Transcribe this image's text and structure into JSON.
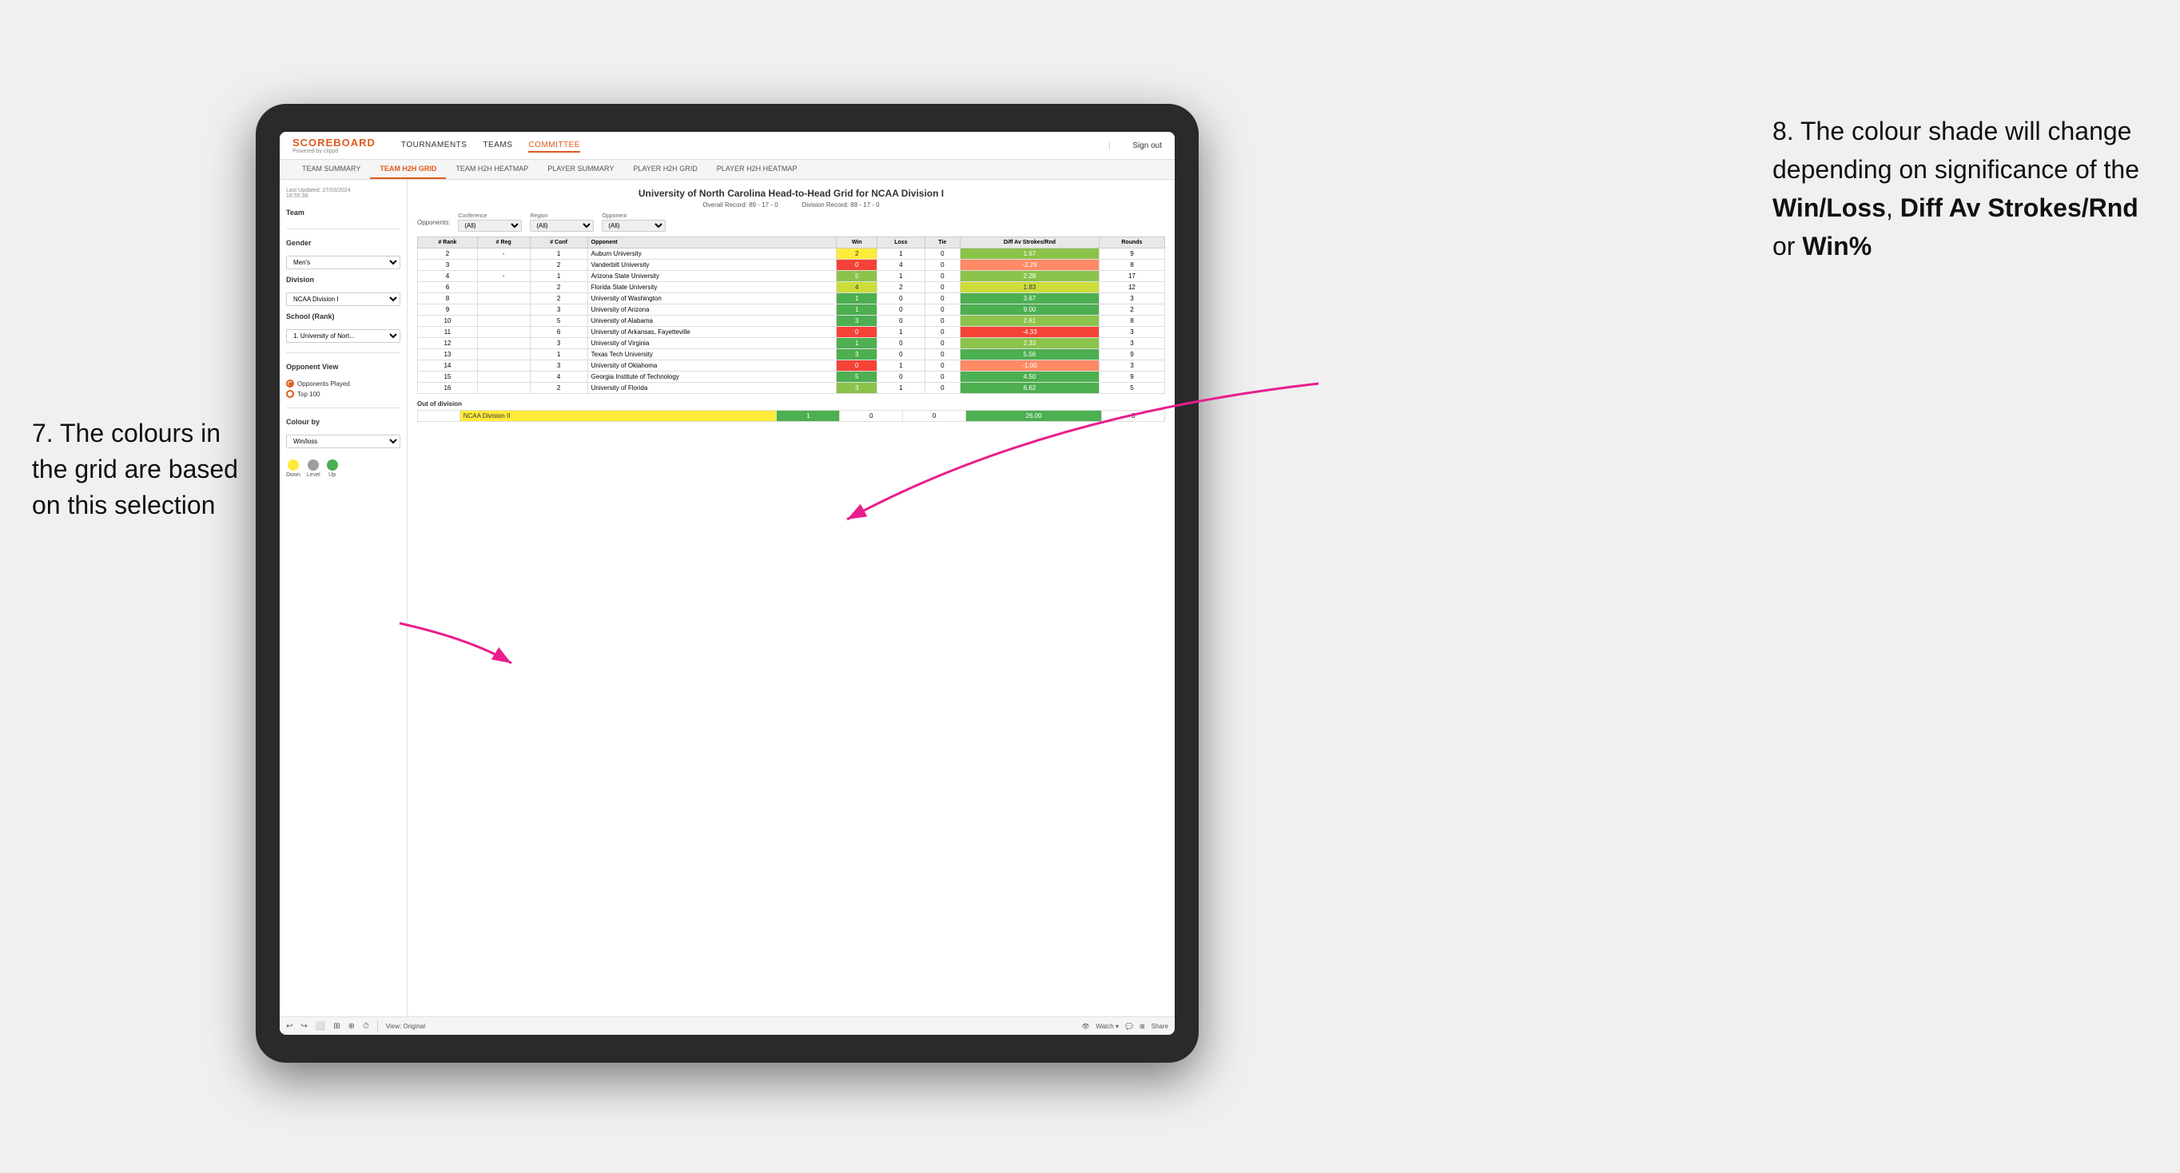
{
  "annotations": {
    "left_text": "7. The colours in the grid are based on this selection",
    "right_title": "8. The colour shade will change depending on significance of the",
    "right_bold1": "Win/Loss",
    "right_comma": ", ",
    "right_bold2": "Diff Av Strokes/Rnd",
    "right_or": " or ",
    "right_bold3": "Win%"
  },
  "nav": {
    "logo": "SCOREBOARD",
    "logo_sub": "Powered by clippd",
    "links": [
      "TOURNAMENTS",
      "TEAMS",
      "COMMITTEE"
    ],
    "sign_out": "Sign out"
  },
  "sub_tabs": [
    "TEAM SUMMARY",
    "TEAM H2H GRID",
    "TEAM H2H HEATMAP",
    "PLAYER SUMMARY",
    "PLAYER H2H GRID",
    "PLAYER H2H HEATMAP"
  ],
  "active_sub_tab": "TEAM H2H GRID",
  "left_panel": {
    "last_updated_label": "Last Updated: 27/03/2024",
    "last_updated_time": "16:55:38",
    "team_label": "Team",
    "gender_label": "Gender",
    "gender_value": "Men's",
    "division_label": "Division",
    "division_value": "NCAA Division I",
    "school_rank_label": "School (Rank)",
    "school_value": "1. University of Nort...",
    "opponent_view_label": "Opponent View",
    "opponents_played": "Opponents Played",
    "top100": "Top 100",
    "colour_by_label": "Colour by",
    "colour_by_value": "Win/loss",
    "legend": {
      "down_label": "Down",
      "level_label": "Level",
      "up_label": "Up",
      "down_color": "#ffeb3b",
      "level_color": "#9e9e9e",
      "up_color": "#4caf50"
    }
  },
  "grid": {
    "title": "University of North Carolina Head-to-Head Grid for NCAA Division I",
    "overall_record": "Overall Record: 89 - 17 - 0",
    "division_record": "Division Record: 88 - 17 - 0",
    "filter_conference_label": "Conference",
    "filter_conference_value": "(All)",
    "filter_region_label": "Region",
    "filter_region_value": "(All)",
    "filter_opponent_label": "Opponent",
    "filter_opponent_value": "(All)",
    "opponents_label": "Opponents:",
    "columns": [
      "#\nRank",
      "#\nReg",
      "#\nConf",
      "Opponent",
      "Win",
      "Loss",
      "Tie",
      "Diff Av\nStrokes/Rnd",
      "Rounds"
    ],
    "rows": [
      {
        "rank": "2",
        "reg": "-",
        "conf": "1",
        "opponent": "Auburn University",
        "win": "2",
        "loss": "1",
        "tie": "0",
        "diff": "1.67",
        "rounds": "9",
        "win_color": "yellow",
        "diff_color": "green_mid"
      },
      {
        "rank": "3",
        "reg": "",
        "conf": "2",
        "opponent": "Vanderbilt University",
        "win": "0",
        "loss": "4",
        "tie": "0",
        "diff": "-2.29",
        "rounds": "8",
        "win_color": "red_mid",
        "diff_color": "red_light"
      },
      {
        "rank": "4",
        "reg": "-",
        "conf": "1",
        "opponent": "Arizona State University",
        "win": "5",
        "loss": "1",
        "tie": "0",
        "diff": "2.28",
        "rounds": "17",
        "win_color": "green_mid",
        "diff_color": "green_mid"
      },
      {
        "rank": "6",
        "reg": "",
        "conf": "2",
        "opponent": "Florida State University",
        "win": "4",
        "loss": "2",
        "tie": "0",
        "diff": "1.83",
        "rounds": "12",
        "win_color": "green_light",
        "diff_color": "green_light"
      },
      {
        "rank": "8",
        "reg": "",
        "conf": "2",
        "opponent": "University of Washington",
        "win": "1",
        "loss": "0",
        "tie": "0",
        "diff": "3.67",
        "rounds": "3",
        "win_color": "green_strong",
        "diff_color": "green_strong"
      },
      {
        "rank": "9",
        "reg": "",
        "conf": "3",
        "opponent": "University of Arizona",
        "win": "1",
        "loss": "0",
        "tie": "0",
        "diff": "9.00",
        "rounds": "2",
        "win_color": "green_strong",
        "diff_color": "green_strong"
      },
      {
        "rank": "10",
        "reg": "",
        "conf": "5",
        "opponent": "University of Alabama",
        "win": "3",
        "loss": "0",
        "tie": "0",
        "diff": "2.61",
        "rounds": "8",
        "win_color": "green_strong",
        "diff_color": "green_mid"
      },
      {
        "rank": "11",
        "reg": "",
        "conf": "6",
        "opponent": "University of Arkansas, Fayetteville",
        "win": "0",
        "loss": "1",
        "tie": "0",
        "diff": "-4.33",
        "rounds": "3",
        "win_color": "red_mid",
        "diff_color": "red_mid"
      },
      {
        "rank": "12",
        "reg": "",
        "conf": "3",
        "opponent": "University of Virginia",
        "win": "1",
        "loss": "0",
        "tie": "0",
        "diff": "2.33",
        "rounds": "3",
        "win_color": "green_strong",
        "diff_color": "green_mid"
      },
      {
        "rank": "13",
        "reg": "",
        "conf": "1",
        "opponent": "Texas Tech University",
        "win": "3",
        "loss": "0",
        "tie": "0",
        "diff": "5.56",
        "rounds": "9",
        "win_color": "green_strong",
        "diff_color": "green_strong"
      },
      {
        "rank": "14",
        "reg": "",
        "conf": "3",
        "opponent": "University of Oklahoma",
        "win": "0",
        "loss": "1",
        "tie": "0",
        "diff": "-1.00",
        "rounds": "3",
        "win_color": "red_mid",
        "diff_color": "red_light"
      },
      {
        "rank": "15",
        "reg": "",
        "conf": "4",
        "opponent": "Georgia Institute of Technology",
        "win": "5",
        "loss": "0",
        "tie": "0",
        "diff": "4.50",
        "rounds": "9",
        "win_color": "green_strong",
        "diff_color": "green_strong"
      },
      {
        "rank": "16",
        "reg": "",
        "conf": "2",
        "opponent": "University of Florida",
        "win": "3",
        "loss": "1",
        "tie": "0",
        "diff": "6.62",
        "rounds": "5",
        "win_color": "green_mid",
        "diff_color": "green_strong"
      }
    ],
    "out_of_division_label": "Out of division",
    "out_of_division_row": {
      "division": "NCAA Division II",
      "win": "1",
      "loss": "0",
      "tie": "0",
      "diff": "26.00",
      "rounds": "3",
      "diff_color": "green_strong"
    }
  },
  "toolbar": {
    "view_label": "View: Original",
    "watch_label": "Watch ▾",
    "share_label": "Share"
  }
}
